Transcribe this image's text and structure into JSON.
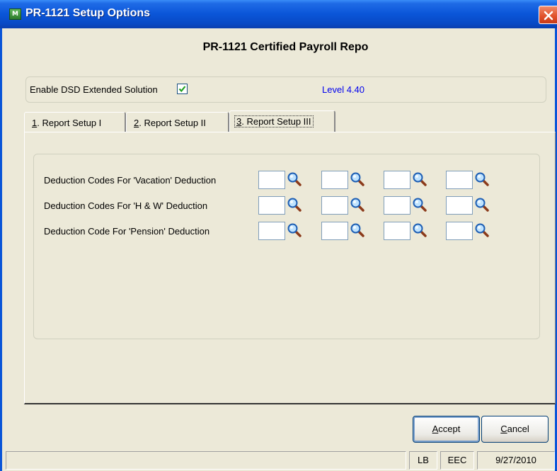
{
  "window": {
    "title": "PR-1121 Setup Options",
    "icon": "app-icon-mas",
    "icon_text": "M"
  },
  "header": {
    "title": "PR-1121 Certified Payroll Repo"
  },
  "options": {
    "enable_label": "Enable DSD Extended Solution",
    "enable_checked": true,
    "level": "Level  4.40",
    "level_color": "#0000ee"
  },
  "tabs": [
    {
      "num": "1",
      "label": ". Report Setup I",
      "active": false
    },
    {
      "num": "2",
      "label": ". Report Setup II",
      "active": false
    },
    {
      "num": "3",
      "label": ". Report Setup III",
      "active": true
    }
  ],
  "rows": [
    {
      "label": "Deduction Codes For 'Vacation' Deduction",
      "codes": [
        "",
        "",
        "",
        ""
      ]
    },
    {
      "label": "Deduction Codes For 'H & W' Deduction",
      "codes": [
        "",
        "",
        "",
        ""
      ]
    },
    {
      "label": "Deduction Code For 'Pension' Deduction",
      "codes": [
        "",
        "",
        "",
        ""
      ]
    }
  ],
  "buttons": {
    "accept_u": "A",
    "accept_rest": "ccept",
    "cancel_u": "C",
    "cancel_rest": "ancel"
  },
  "status": {
    "main": "",
    "user": "LB",
    "company": "EEC",
    "date": "9/27/2010"
  },
  "colors": {
    "titlebar": "#0a55d8",
    "background": "#ece9d8",
    "close": "#e0502a",
    "check": "#21a121"
  }
}
